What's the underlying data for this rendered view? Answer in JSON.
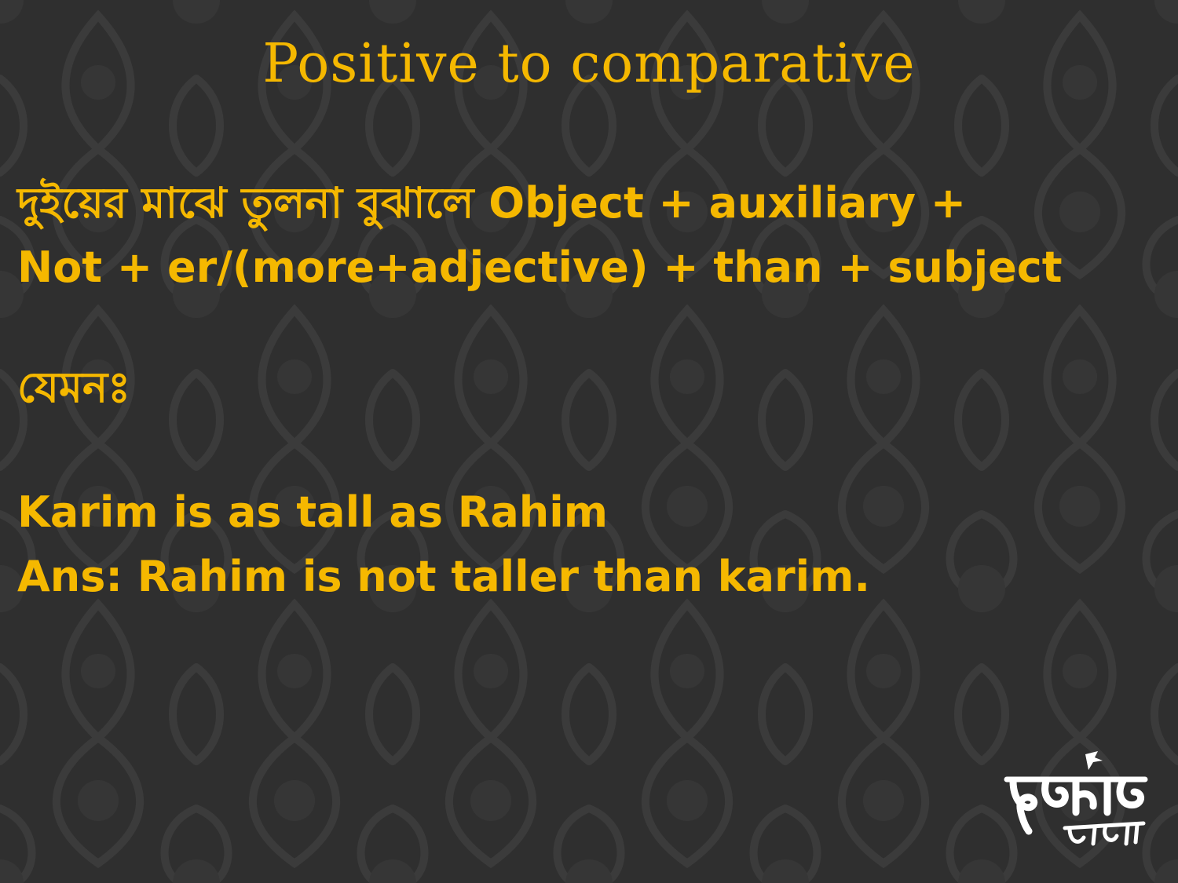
{
  "slide": {
    "title": "Positive to comparative",
    "rule": {
      "line1": "দুইয়ের মাঝে তুলনা বুঝালে Object + auxiliary +",
      "line2": "Not + er/(more+adjective) + than + subject"
    },
    "example_label": "যেমনঃ",
    "example": {
      "question": "Karim is as tall as Rahim",
      "answer": "Ans: Rahim is not taller than karim."
    }
  },
  "logo": {
    "text_main": "দুর্নিবার",
    "text_sub": "পাঠশালা"
  },
  "colors": {
    "background": "#2f2f2f",
    "pattern": "#3a3a3a",
    "accent": "#f5b800",
    "logo": "#ffffff"
  }
}
